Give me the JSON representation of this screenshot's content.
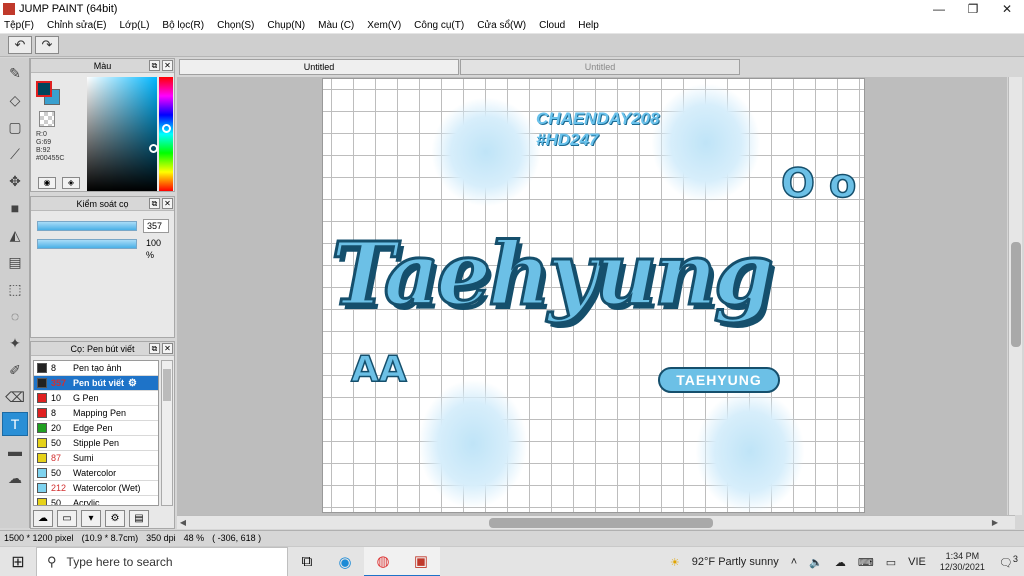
{
  "window": {
    "title": "JUMP PAINT (64bit)",
    "min": "—",
    "max": "❐",
    "close": "✕"
  },
  "menu": [
    "Tệp(F)",
    "Chỉnh sửa(E)",
    "Lớp(L)",
    "Bộ lọc(R)",
    "Chọn(S)",
    "Chụp(N)",
    "Màu (C)",
    "Xem(V)",
    "Công cụ(T)",
    "Cửa sổ(W)",
    "Cloud",
    "Help"
  ],
  "toolbar": {
    "undo_icon": "undo-icon",
    "redo_icon": "redo-icon"
  },
  "color_panel": {
    "title": "Màu",
    "foreground": "#00455C",
    "background": "#3AA0CF",
    "r": "R:0",
    "g": "G:69",
    "b": "B:92",
    "hex": "#00455C"
  },
  "control_panel": {
    "title": "Kiểm soát cọ",
    "size_value": "357",
    "opacity_value": "100 %"
  },
  "brush_panel": {
    "title": "Cọ: Pen bút viết",
    "items": [
      {
        "size": "8",
        "name": "Pen tạo ảnh",
        "color": "#222222",
        "red": false
      },
      {
        "size": "357",
        "name": "Pen bút viết",
        "color": "#222222",
        "red": true
      },
      {
        "size": "10",
        "name": "G Pen",
        "color": "#e02020",
        "red": false
      },
      {
        "size": "8",
        "name": "Mapping Pen",
        "color": "#e02020",
        "red": false
      },
      {
        "size": "20",
        "name": "Edge Pen",
        "color": "#20a020",
        "red": false
      },
      {
        "size": "50",
        "name": "Stipple Pen",
        "color": "#e6d21a",
        "red": false
      },
      {
        "size": "87",
        "name": "Sumi",
        "color": "#e6d21a",
        "red": true
      },
      {
        "size": "50",
        "name": "Watercolor",
        "color": "#7fd3ef",
        "red": false
      },
      {
        "size": "212",
        "name": "Watercolor (Wet)",
        "color": "#7fd3ef",
        "red": true
      },
      {
        "size": "50",
        "name": "Acrylic",
        "color": "#e6d21a",
        "red": false
      }
    ]
  },
  "tabs": {
    "active": "Untitled",
    "inactive": "Untitled"
  },
  "canvas_art": {
    "tag1": "CHAENDAY208",
    "tag2": "#HD247",
    "main_word": "Taehyung",
    "badge": "TAEHYUNG",
    "deco_oo": "O o",
    "deco_aa": "AA",
    "accent_color": "#6CC0E6",
    "stroke_color": "#154F6C"
  },
  "status": {
    "size": "1500 * 1200 pixel",
    "cm": "(10.9 * 8.7cm)",
    "dpi": "350 dpi",
    "zoom": "48 %",
    "coords": "( -306, 618 )"
  },
  "taskbar": {
    "search_placeholder": "Type here to search",
    "weather": "92°F  Partly sunny",
    "lang": "VIE",
    "time": "1:34 PM",
    "date": "12/30/2021",
    "notif": "3"
  }
}
